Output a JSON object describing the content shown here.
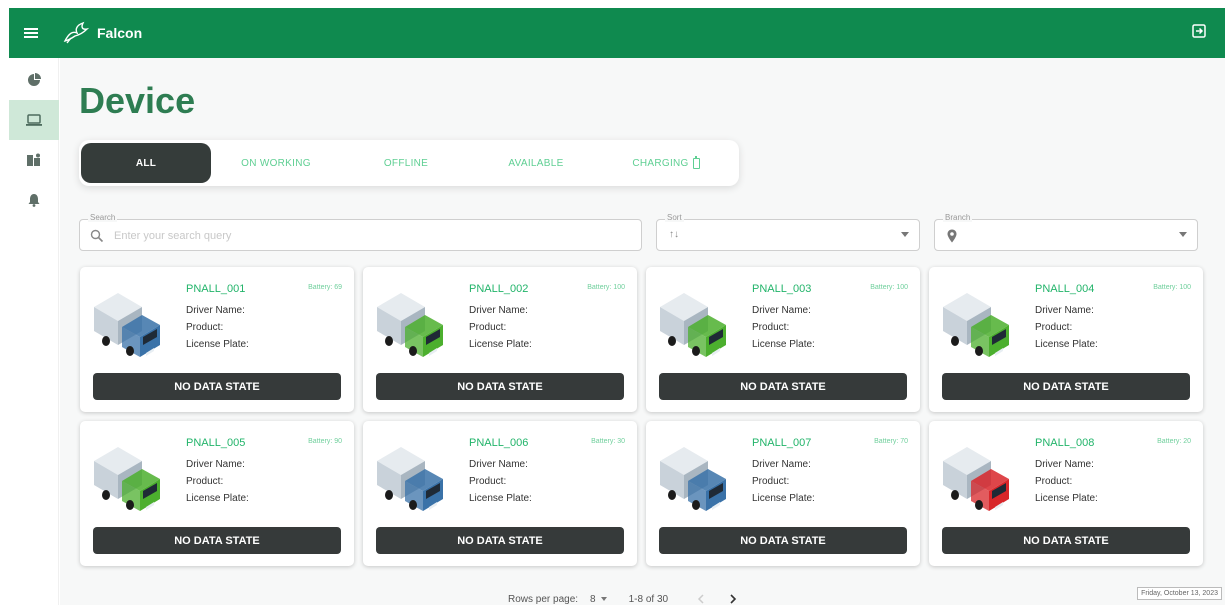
{
  "app": {
    "name": "Falcon"
  },
  "sidebar": {
    "items": [
      {
        "name": "dashboard",
        "icon": "pie-chart-icon",
        "active": false
      },
      {
        "name": "device",
        "icon": "laptop-icon",
        "active": true
      },
      {
        "name": "map",
        "icon": "map-icon",
        "active": false
      },
      {
        "name": "notifications",
        "icon": "bell-icon",
        "active": false
      }
    ]
  },
  "page": {
    "title": "Device"
  },
  "tabs": [
    {
      "label": "ALL",
      "active": true
    },
    {
      "label": "ON WORKING",
      "active": false
    },
    {
      "label": "OFFLINE",
      "active": false
    },
    {
      "label": "AVAILABLE",
      "active": false
    },
    {
      "label": "CHARGING",
      "active": false
    }
  ],
  "filters": {
    "search_label": "Search",
    "search_placeholder": "Enter your search query",
    "sort_label": "Sort",
    "sort_value": "↑↓",
    "branch_label": "Branch"
  },
  "card_labels": {
    "driver": "Driver Name:",
    "product": "Product:",
    "plate": "License Plate:",
    "state": "NO DATA STATE"
  },
  "devices": [
    {
      "id": "PNALL_001",
      "battery": "Battery: 69",
      "cab_color": "#3a72a8"
    },
    {
      "id": "PNALL_002",
      "battery": "Battery: 100",
      "cab_color": "#4caf2e"
    },
    {
      "id": "PNALL_003",
      "battery": "Battery: 100",
      "cab_color": "#4caf2e"
    },
    {
      "id": "PNALL_004",
      "battery": "Battery: 100",
      "cab_color": "#4caf2e"
    },
    {
      "id": "PNALL_005",
      "battery": "Battery: 90",
      "cab_color": "#4caf2e"
    },
    {
      "id": "PNALL_006",
      "battery": "Battery: 30",
      "cab_color": "#3a72a8"
    },
    {
      "id": "PNALL_007",
      "battery": "Battery: 70",
      "cab_color": "#3a72a8"
    },
    {
      "id": "PNALL_008",
      "battery": "Battery: 20",
      "cab_color": "#d8262a"
    }
  ],
  "pagination": {
    "rows_label": "Rows per page:",
    "rows_value": "8",
    "range": "1-8 of 30"
  },
  "datestamp": "Friday, October 13, 2023",
  "colors": {
    "primary": "#0f8a4f",
    "accent": "#22b46a",
    "dark": "#363a3a"
  }
}
